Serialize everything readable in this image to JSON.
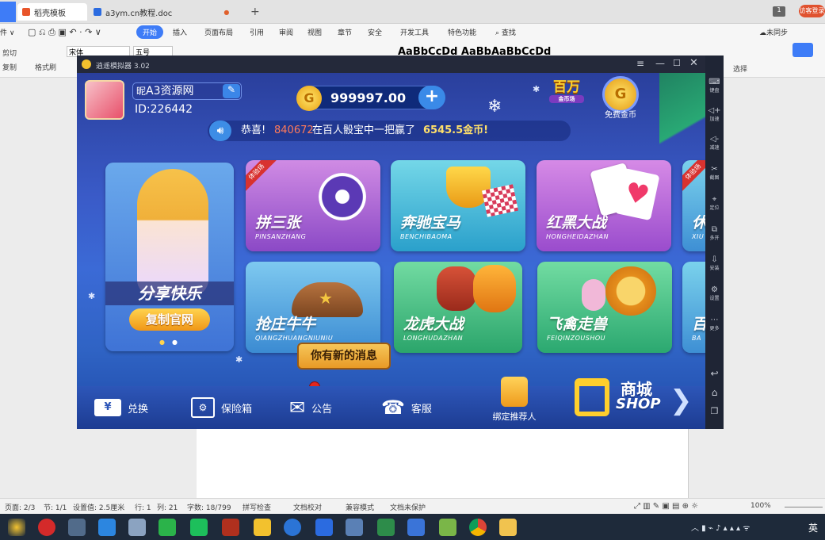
{
  "browser_tabs": [
    {
      "label": "稻壳模板"
    },
    {
      "label": "a3ym.cn教程.doc"
    }
  ],
  "wps_header": {
    "badge": "1",
    "user_label": "访客登录"
  },
  "ribbon": {
    "tabs": [
      "开始",
      "插入",
      "页面布局",
      "引用",
      "审阅",
      "视图",
      "章节",
      "安全",
      "开发工具",
      "特色功能"
    ],
    "search_label": "查找",
    "cloud_label": "未同步",
    "font_name": "宋体",
    "font_size": "五号",
    "left_tools": [
      "剪切",
      "复制",
      "格式刷"
    ],
    "styles_preview": "AaBbCcDd AaBbAaBbCcDd",
    "select_label": "选择"
  },
  "emulator": {
    "title": "逍遥模拟器 3.02",
    "side_items": [
      "键盘",
      "加速",
      "减速",
      "截图",
      "定位",
      "多开",
      "安装",
      "设置",
      "更多"
    ]
  },
  "game": {
    "player": {
      "nickname": "A3资源网",
      "nick_prefix": "昵",
      "id_label": "ID:226442"
    },
    "coins": "999997.00",
    "notice": {
      "prefix": "恭喜!",
      "user": "840672",
      "text": "在百人骰宝中一把赢了",
      "amount": "6545.5金币!"
    },
    "million_label": "百万",
    "free_coin_label": "免费金币",
    "promo": {
      "title": "分享快乐",
      "button": "复制官网"
    },
    "games": [
      {
        "title": "拼三张",
        "sub": "PINSANZHANG",
        "badge": "体验场",
        "color1": "#c77de0",
        "color2": "#8a48c6"
      },
      {
        "title": "奔驰宝马",
        "sub": "BENCHIBAOMA",
        "color1": "#64d2e4",
        "color2": "#2a9ec9"
      },
      {
        "title": "红黑大战",
        "sub": "HONGHEIDAZHAN",
        "color1": "#d179e0",
        "color2": "#9a4ccd"
      },
      {
        "title": "抢庄牛牛",
        "sub": "QIANGZHUANGNIUNIU",
        "color1": "#6fc7ef",
        "color2": "#3a8fd0"
      },
      {
        "title": "龙虎大战",
        "sub": "LONGHUDAZHAN",
        "color1": "#66d79a",
        "color2": "#2ca86b"
      },
      {
        "title": "飞禽走兽",
        "sub": "FEIQINZOUSHOU",
        "color1": "#69d99a",
        "color2": "#2aa871"
      },
      {
        "title": "休",
        "sub": "XIU",
        "badge": "体验场"
      },
      {
        "title": "百",
        "sub": "BA"
      }
    ],
    "message_bubble": "你有新的消息",
    "bottom": {
      "exchange": "兑换",
      "safe": "保险箱",
      "notice": "公告",
      "service": "客服",
      "bind": "绑定推荐人",
      "shop": "商城",
      "shop_en": "SHOP"
    }
  },
  "status_bar": {
    "page": "页面: 2/3",
    "section": "节: 1/1",
    "setting": "设置值: 2.5厘米",
    "row": "行: 1",
    "col": "列: 21",
    "words": "字数: 18/799",
    "spell": "拼写检查",
    "proof": "文档校对",
    "compat": "兼容模式",
    "protect": "文档未保护",
    "zoom": "100%"
  },
  "taskbar": {
    "ime": "英"
  }
}
